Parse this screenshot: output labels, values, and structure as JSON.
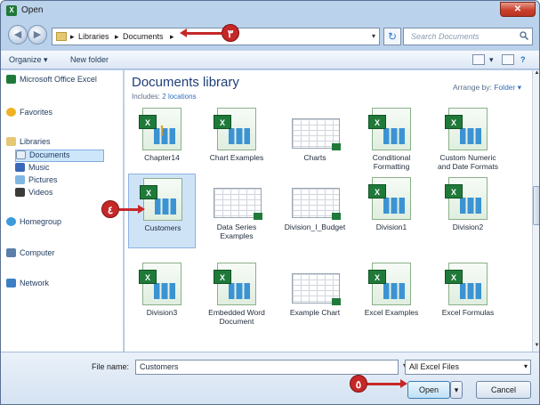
{
  "window": {
    "title": "Open",
    "close_icon": "close-icon"
  },
  "address": {
    "segments": [
      "Libraries",
      "Documents"
    ],
    "search_placeholder": "Search Documents"
  },
  "toolbar": {
    "organize": "Organize ▾",
    "new_folder": "New folder"
  },
  "nav": {
    "items": [
      {
        "label": "Microsoft Office Excel",
        "icon": "excel-icon"
      },
      {
        "label": "Favorites",
        "icon": "star-icon"
      },
      {
        "label": "Libraries",
        "icon": "library-icon"
      },
      {
        "label": "Documents",
        "icon": "documents-icon"
      },
      {
        "label": "Music",
        "icon": "music-icon"
      },
      {
        "label": "Pictures",
        "icon": "pictures-icon"
      },
      {
        "label": "Videos",
        "icon": "videos-icon"
      },
      {
        "label": "Homegroup",
        "icon": "homegroup-icon"
      },
      {
        "label": "Computer",
        "icon": "computer-icon"
      },
      {
        "label": "Network",
        "icon": "network-icon"
      }
    ]
  },
  "library": {
    "title": "Documents library",
    "includes_prefix": "Includes:",
    "includes_link": "2 locations",
    "arrange_label": "Arrange by:",
    "arrange_value": "Folder ▾"
  },
  "files": [
    {
      "name": "Chapter14",
      "kind": "excel"
    },
    {
      "name": "Chart Examples",
      "kind": "excel"
    },
    {
      "name": "Charts",
      "kind": "sheet"
    },
    {
      "name": "Conditional Formatting",
      "kind": "excel"
    },
    {
      "name": "Custom Numeric and Date Formats",
      "kind": "excel"
    },
    {
      "name": "Customers",
      "kind": "excel"
    },
    {
      "name": "Data Series Examples",
      "kind": "sheet"
    },
    {
      "name": "Division_I_Budget",
      "kind": "sheet"
    },
    {
      "name": "Division1",
      "kind": "excel"
    },
    {
      "name": "Division2",
      "kind": "excel"
    },
    {
      "name": "Division3",
      "kind": "excel"
    },
    {
      "name": "Embedded Word Document",
      "kind": "excel"
    },
    {
      "name": "Example Chart",
      "kind": "sheet"
    },
    {
      "name": "Excel Examples",
      "kind": "excel"
    },
    {
      "name": "Excel Formulas",
      "kind": "excel"
    }
  ],
  "bottom": {
    "file_name_label": "File name:",
    "file_name_value": "Customers",
    "file_type": "All Excel Files",
    "open": "Open",
    "cancel": "Cancel"
  },
  "callouts": {
    "step3": "٣",
    "step4": "٤",
    "step5": "٥"
  },
  "colors": {
    "accent": "#c62828",
    "selection": "#cfe3f7",
    "link": "#2f6fbf"
  }
}
